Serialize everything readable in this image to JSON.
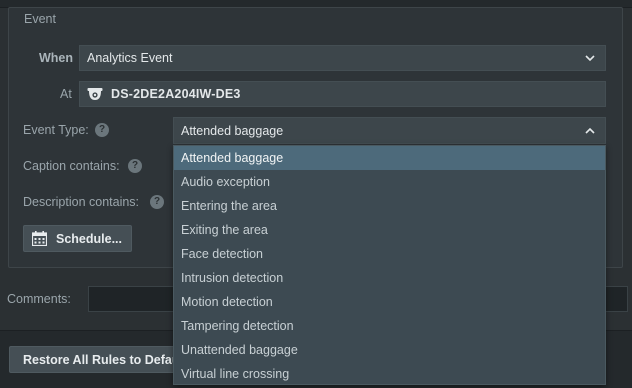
{
  "event_group": {
    "legend": "Event",
    "when_label": "When",
    "when_value": "Analytics Event",
    "at_label": "At",
    "at_value": "DS-2DE2A204IW-DE3",
    "event_type_label": "Event Type:",
    "event_type_value": "Attended baggage",
    "caption_label": "Caption contains:",
    "description_label": "Description contains:",
    "help_glyph": "?",
    "schedule_label": "Schedule..."
  },
  "comments_label": "Comments:",
  "restore_label": "Restore All Rules to Defaults",
  "event_type_options": [
    "Attended baggage",
    "Audio exception",
    "Entering the area",
    "Exiting the area",
    "Face detection",
    "Intrusion detection",
    "Motion detection",
    "Tampering detection",
    "Unattended baggage",
    "Virtual line crossing"
  ],
  "selected_option_index": 0,
  "icons": {
    "camera": "dome-camera-icon",
    "calendar": "calendar-icon",
    "chevron_down": "chevron-down-icon",
    "chevron_up": "chevron-up-icon"
  },
  "colors": {
    "background": "#2b3033",
    "field": "#3d464b",
    "dropdown": "#3d4a52",
    "selected_option": "#4d6a7b"
  }
}
